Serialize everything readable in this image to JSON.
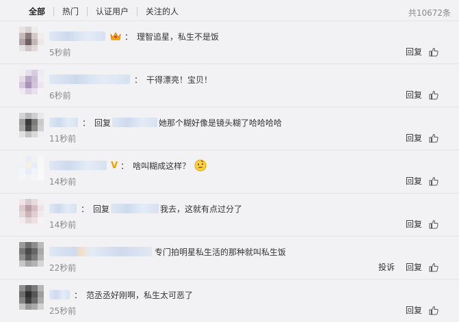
{
  "tabs": [
    "全部",
    "热门",
    "认证用户",
    "关注的人"
  ],
  "total_count": "共10672条",
  "labels": {
    "reply": "回复",
    "report": "投诉",
    "reply_prefix": "回复"
  },
  "comments": [
    {
      "text": "理智追星，私生不是饭",
      "time": "5秒前",
      "avatar": [
        "#e8e3e3",
        "#d9d2d2",
        "#ececec",
        "#f3f3f3",
        "#c9b9bb",
        "#8b7d7e",
        "#d5c8c9",
        "#eeeeee",
        "#b4a3a6",
        "#6f6264",
        "#c5b5b8",
        "#e9e9e9",
        "#e6e1e2",
        "#cfc5c6",
        "#e1dada",
        "#f1f1f1"
      ]
    },
    {
      "text": "干得漂亮！宝贝！",
      "time": "6秒前",
      "avatar": [
        "#f1eff3",
        "#e5e0ea",
        "#d7cde1",
        "#eeeaf1",
        "#e3dbe8",
        "#b9a7c6",
        "#ccbfd6",
        "#f0edf2",
        "#d5c7dc",
        "#a993b9",
        "#d2c3da",
        "#ebe5ee",
        "#efeaf2",
        "#dcd2e3",
        "#e7e1eb",
        "#f5f3f6"
      ]
    },
    {
      "reply_to": true,
      "text": "她那个糊好像是镜头糊了哈哈哈哈",
      "time": "11秒前",
      "avatar": [
        "#d4d4d4",
        "#b8b8b8",
        "#cfcfcf",
        "#e8e8e8",
        "#9e9e9e",
        "#3b3b3b",
        "#7b7b7b",
        "#c8c8c8",
        "#a8a8a8",
        "#4b4b4b",
        "#8a8a8a",
        "#d0d0d0",
        "#e1e1e1",
        "#c2c2c2",
        "#d9d9d9",
        "#efefef"
      ]
    },
    {
      "text": "啥叫糊成这样？",
      "time": "14秒前",
      "avatar": [
        "#f3f3f3",
        "#e9eef6",
        "#f1f1f1",
        "#f6f6f6",
        "#eef3f9",
        "#f5f0df",
        "#e8eef7",
        "#f7f7f7",
        "#f2f5fa",
        "#e7eef8",
        "#f0f4fa",
        "#f8f8f8",
        "#f6f6f6",
        "#f3f3f3",
        "#f5f5f5",
        "#fafafa"
      ]
    },
    {
      "reply_to": true,
      "text": "我去，这就有点过分了",
      "time": "14秒前",
      "avatar": [
        "#eee4e6",
        "#d9cacd",
        "#e6dadc",
        "#f3eeef",
        "#ddc9cd",
        "#b9a0a5",
        "#d3bfc3",
        "#ede4e6",
        "#e5d6d9",
        "#cbb5ba",
        "#dfcfd2",
        "#f1eaec",
        "#f3ecee",
        "#e3d6d9",
        "#ece2e4",
        "#f7f3f4"
      ]
    },
    {
      "text": "专门拍明星私生活的那种就叫私生饭",
      "time": "22秒前",
      "report": true,
      "avatar": [
        "#9a9a9a",
        "#6e6e6e",
        "#8d8d8d",
        "#b9b9b9",
        "#777777",
        "#4a4a4a",
        "#666666",
        "#a9a9a9",
        "#8f8f8f",
        "#5c5c5c",
        "#7b7b7b",
        "#b4b4b4",
        "#c7c7c7",
        "#a4a4a4",
        "#b2b2b2",
        "#d6d6d6"
      ]
    },
    {
      "text": "范丞丞好刚啊，私生太可恶了",
      "time": "25秒前",
      "avatar": [
        "#8f8f8f",
        "#5b5b5b",
        "#7a7a7a",
        "#b5b5b5",
        "#6e6e6e",
        "#2f2f2f",
        "#575757",
        "#9d9d9d",
        "#858585",
        "#3f3f3f",
        "#6a6a6a",
        "#ababab",
        "#c4c4c4",
        "#999999",
        "#aaaaaa",
        "#d3d3d3"
      ]
    }
  ]
}
